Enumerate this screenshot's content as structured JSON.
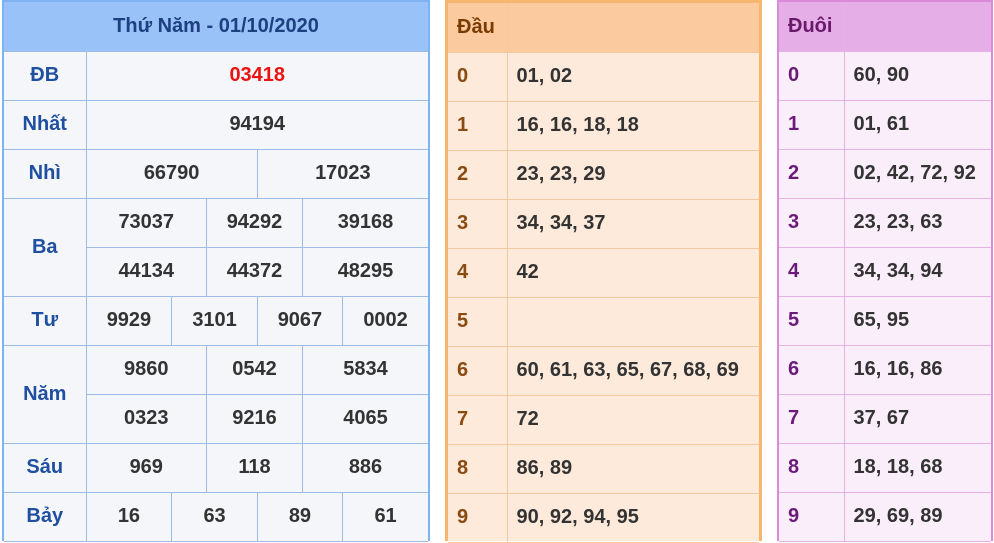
{
  "results": {
    "title": "Thứ Năm - 01/10/2020",
    "db": {
      "label": "ĐB",
      "value": "03418"
    },
    "nhat": {
      "label": "Nhất",
      "value": "94194"
    },
    "nhi": {
      "label": "Nhì",
      "values": [
        "66790",
        "17023"
      ]
    },
    "ba": {
      "label": "Ba",
      "values": [
        "73037",
        "94292",
        "39168",
        "44134",
        "44372",
        "48295"
      ]
    },
    "tu": {
      "label": "Tư",
      "values": [
        "9929",
        "3101",
        "9067",
        "0002"
      ]
    },
    "nam": {
      "label": "Năm",
      "values": [
        "9860",
        "0542",
        "5834",
        "0323",
        "9216",
        "4065"
      ]
    },
    "sau": {
      "label": "Sáu",
      "values": [
        "969",
        "118",
        "886"
      ]
    },
    "bay": {
      "label": "Bảy",
      "values": [
        "16",
        "63",
        "89",
        "61"
      ]
    }
  },
  "dau": {
    "header": "Đầu",
    "rows": [
      {
        "key": "0",
        "val": "01, 02"
      },
      {
        "key": "1",
        "val": "16, 16, 18, 18"
      },
      {
        "key": "2",
        "val": "23, 23, 29"
      },
      {
        "key": "3",
        "val": "34, 34, 37"
      },
      {
        "key": "4",
        "val": "42"
      },
      {
        "key": "5",
        "val": ""
      },
      {
        "key": "6",
        "val": "60, 61, 63, 65, 67, 68, 69"
      },
      {
        "key": "7",
        "val": "72"
      },
      {
        "key": "8",
        "val": "86, 89"
      },
      {
        "key": "9",
        "val": "90, 92, 94, 95"
      }
    ]
  },
  "duoi": {
    "header": "Đuôi",
    "rows": [
      {
        "key": "0",
        "val": "60, 90"
      },
      {
        "key": "1",
        "val": "01, 61"
      },
      {
        "key": "2",
        "val": "02, 42, 72, 92"
      },
      {
        "key": "3",
        "val": "23, 23, 63"
      },
      {
        "key": "4",
        "val": "34, 34, 94"
      },
      {
        "key": "5",
        "val": "65, 95"
      },
      {
        "key": "6",
        "val": "16, 16, 86"
      },
      {
        "key": "7",
        "val": "37, 67"
      },
      {
        "key": "8",
        "val": "18, 18, 68"
      },
      {
        "key": "9",
        "val": "29, 69, 89"
      }
    ]
  }
}
